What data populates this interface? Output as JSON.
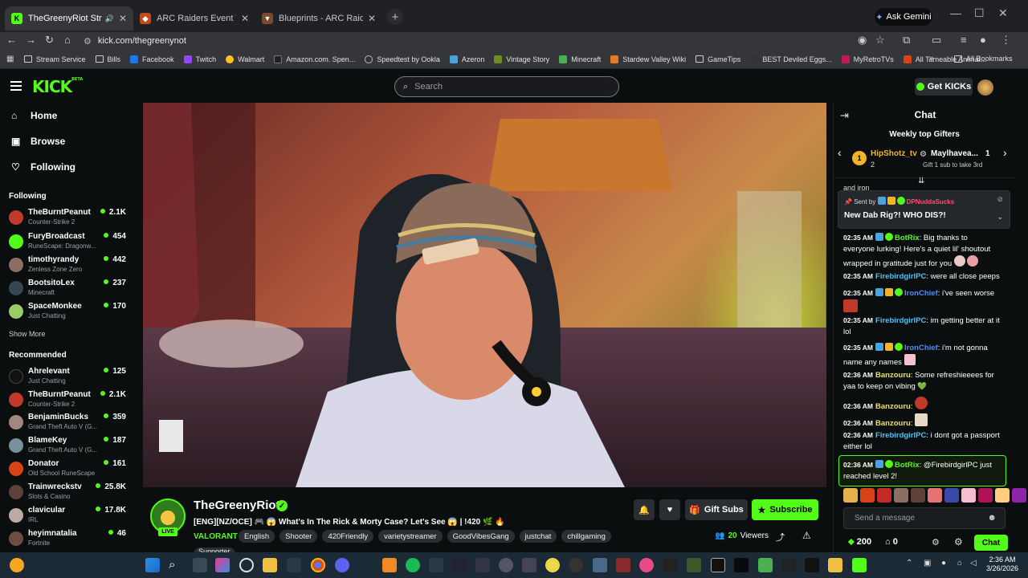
{
  "browser": {
    "tabs": [
      {
        "title": "TheGreenyRiot Stream - W",
        "icon": "kick-icon",
        "active": true
      },
      {
        "title": "ARC Raiders Event Timers | Met",
        "icon": "arc-icon",
        "active": false
      },
      {
        "title": "Blueprints - ARC Raiders Wiki",
        "icon": "wiki-icon",
        "active": false
      }
    ],
    "gemini_label": "Ask Gemini",
    "url": "kick.com/thegreenynot",
    "bookmarks": [
      "Stream Service",
      "Bills",
      "Facebook",
      "Twitch",
      "Walmart",
      "Amazon.com. Spen...",
      "Speedtest by Ookla",
      "Azeron",
      "Vintage Story",
      "Minecraft",
      "Stardew Valley Wiki",
      "GameTips",
      "BEST Deviled Eggs...",
      "MyRetroTVs",
      "All Tameable Animal..."
    ],
    "all_bookmarks": "All Bookmarks"
  },
  "site": {
    "logo": "KICK",
    "logo_beta": "BETA",
    "search_placeholder": "Search",
    "get_kicks": "Get KICKs"
  },
  "sidebar": {
    "nav": [
      {
        "label": "Home",
        "icon": "home-icon"
      },
      {
        "label": "Browse",
        "icon": "browse-icon"
      },
      {
        "label": "Following",
        "icon": "heart-icon"
      }
    ],
    "following_heading": "Following",
    "following": [
      {
        "name": "TheBurntPeanut",
        "game": "Counter-Strike 2",
        "viewers": "2.1K"
      },
      {
        "name": "FuryBroadcast",
        "game": "RuneScape: Dragonw...",
        "viewers": "454"
      },
      {
        "name": "timothyrandy",
        "game": "Zenless Zone Zero",
        "viewers": "442"
      },
      {
        "name": "BootsitoLex",
        "game": "Minecraft",
        "viewers": "237"
      },
      {
        "name": "SpaceMonkee",
        "game": "Just Chatting",
        "viewers": "170"
      }
    ],
    "show_more": "Show More",
    "recommended_heading": "Recommended",
    "recommended": [
      {
        "name": "Ahrelevant",
        "game": "Just Chatting",
        "viewers": "125"
      },
      {
        "name": "TheBurntPeanut",
        "game": "Counter-Strike 2",
        "viewers": "2.1K"
      },
      {
        "name": "BenjaminBucks",
        "game": "Grand Theft Auto V (G...",
        "viewers": "359"
      },
      {
        "name": "BlameKey",
        "game": "Grand Theft Auto V (G...",
        "viewers": "187"
      },
      {
        "name": "Donator",
        "game": "Old School RuneScape",
        "viewers": "161"
      },
      {
        "name": "Trainwreckstv",
        "game": "Slots & Casino",
        "viewers": "25.8K"
      },
      {
        "name": "clavicular",
        "game": "IRL",
        "viewers": "17.8K"
      },
      {
        "name": "heyimnatalia",
        "game": "Fortnite",
        "viewers": "46"
      }
    ]
  },
  "stream": {
    "channel": "TheGreenyRiot",
    "live_badge": "LIVE",
    "title": "[ENG][NZ/OCE] 🎮 😱 What's In The Rick & Morty Case? Let's See 😱 | !420 🌿 🔥",
    "category": "VALORANT",
    "tags": [
      "English",
      "Shooter",
      "420Friendly",
      "varietystreamer",
      "GoodVibesGang",
      "justchat",
      "chillgaming"
    ],
    "extra_tag": "Supporter",
    "gift_subs": "Gift Subs",
    "subscribe": "Subscribe",
    "viewers": "20",
    "viewers_label": "Viewers"
  },
  "chat": {
    "title": "Chat",
    "gifters_title": "Weekly top Gifters",
    "gifter1": {
      "rank": "1",
      "name": "HipShotz_tv",
      "count": "2"
    },
    "gifter2": {
      "name": "Maylhavea...",
      "count": "1"
    },
    "gifter_hint": "Gift 1 sub to take 3rd",
    "cut_text": "and iron",
    "pinned": {
      "sent_by_label": "Sent by",
      "sender": "DPNuddaSucks",
      "text": "New Dab Rig?! WHO DIS?!"
    },
    "messages": [
      {
        "time": "02:35 AM",
        "user": "BotRix",
        "color": "#53fc18",
        "text": ": Big thanks to everyone lurking! Here's a quiet lil' shoutout wrapped in gratitude just for you"
      },
      {
        "time": "02:35 AM",
        "user": "FirebirdgirlPC",
        "color": "#4fc3f7",
        "text": ": were all close peeps"
      },
      {
        "time": "02:35 AM",
        "user": "IronChief",
        "color": "#4f8cff",
        "text": ": i've seen worse"
      },
      {
        "time": "02:35 AM",
        "user": "FirebirdgirlPC",
        "color": "#4fc3f7",
        "text": ": im getting better at it lol"
      },
      {
        "time": "02:35 AM",
        "user": "IronChief",
        "color": "#4f8cff",
        "text": ": i'm not gonna name any names"
      },
      {
        "time": "02:36 AM",
        "user": "Banzouru",
        "color": "#f0e060",
        "text": ": Some refreshieeees for yaa to keep on vibing 💚"
      },
      {
        "time": "02:36 AM",
        "user": "Banzouru",
        "color": "#f0e060",
        "text": ":"
      },
      {
        "time": "02:36 AM",
        "user": "Banzouru",
        "color": "#f0e060",
        "text": ":"
      },
      {
        "time": "02:36 AM",
        "user": "FirebirdgirlPC",
        "color": "#4fc3f7",
        "text": ": i dont got a passport either lol"
      },
      {
        "time": "02:36 AM",
        "user": "BotRix",
        "color": "#53fc18",
        "text": ": @FirebirdgirlPC just reached level 2!"
      }
    ],
    "send_placeholder": "Send a message",
    "kicks_count": "200",
    "gift_count": "0",
    "chat_button": "Chat"
  },
  "taskbar": {
    "time": "2:36 AM",
    "date": "3/26/2026"
  },
  "colors": {
    "kick_green": "#53fc18",
    "background": "#0b0e0f"
  }
}
